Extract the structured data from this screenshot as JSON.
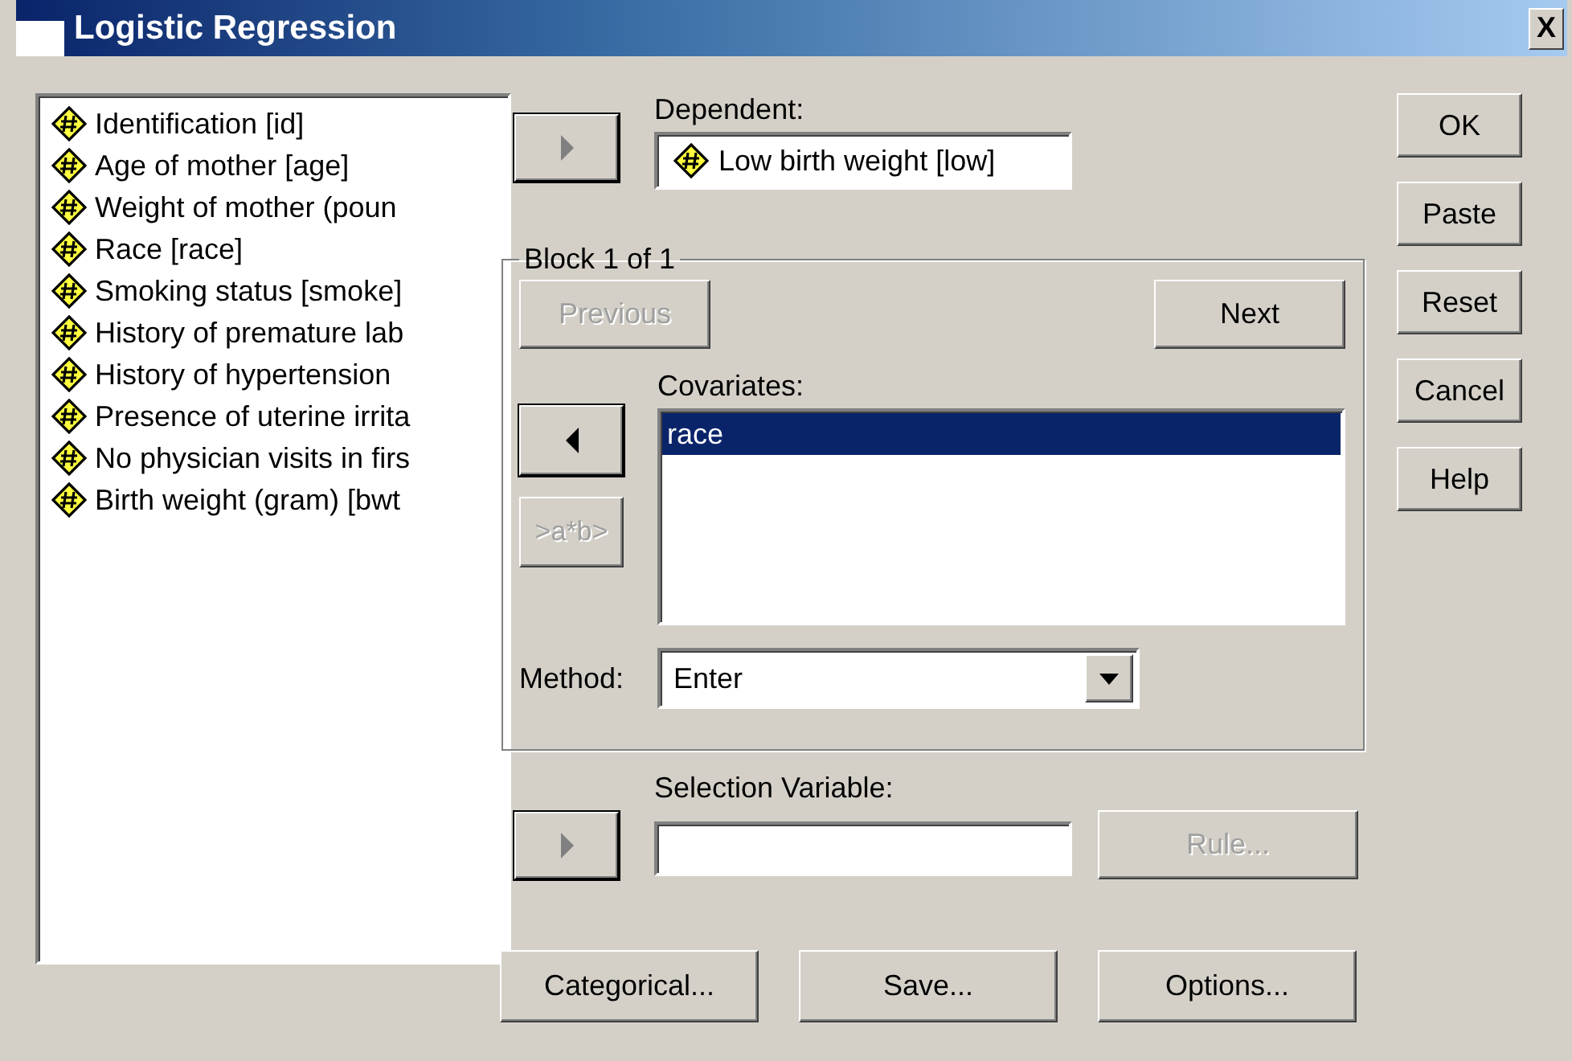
{
  "window": {
    "title": "Logistic Regression",
    "close": "X"
  },
  "variables": [
    {
      "label": "Identification [id]",
      "kind": "scale"
    },
    {
      "label": "Age of mother [age]",
      "kind": "scale"
    },
    {
      "label": "Weight of mother (poun",
      "kind": "scale"
    },
    {
      "label": "Race [race]",
      "kind": "scale"
    },
    {
      "label": "Smoking status [smoke]",
      "kind": "scale"
    },
    {
      "label": "History of premature lab",
      "kind": "scale"
    },
    {
      "label": "History of hypertension",
      "kind": "scale"
    },
    {
      "label": "Presence of uterine irrita",
      "kind": "scale"
    },
    {
      "label": "No physician visits in firs",
      "kind": "scale"
    },
    {
      "label": "Birth weight (gram) [bwt",
      "kind": "scale"
    }
  ],
  "dependent": {
    "label": "Dependent:",
    "move_button": {
      "kind": "right",
      "disabled": true
    },
    "value": {
      "label": "Low birth weight [low]",
      "kind": "scale"
    }
  },
  "block": {
    "label": "Block 1 of 1",
    "previous": {
      "label": "Previous",
      "disabled": true
    },
    "next": {
      "label": "Next",
      "disabled": false
    },
    "covariates_label": "Covariates:",
    "move_button": {
      "kind": "left",
      "disabled": false
    },
    "interaction_button": {
      "label": ">a*b>",
      "disabled": true
    },
    "covariates": [
      {
        "label": "race",
        "selected": true
      }
    ],
    "method_label": "Method:",
    "method": "Enter"
  },
  "selection": {
    "label": "Selection Variable:",
    "move_button": {
      "kind": "right",
      "disabled": true
    },
    "rule": {
      "label": "Rule...",
      "disabled": true
    }
  },
  "bottom_buttons": [
    {
      "label": "Categorical...",
      "disabled": false
    },
    {
      "label": "Save...",
      "disabled": false
    },
    {
      "label": "Options...",
      "disabled": false
    }
  ],
  "side_buttons": [
    {
      "label": "OK",
      "disabled": false
    },
    {
      "label": "Paste",
      "disabled": false
    },
    {
      "label": "Reset",
      "disabled": false
    },
    {
      "label": "Cancel",
      "disabled": false
    },
    {
      "label": "Help",
      "disabled": false
    }
  ]
}
